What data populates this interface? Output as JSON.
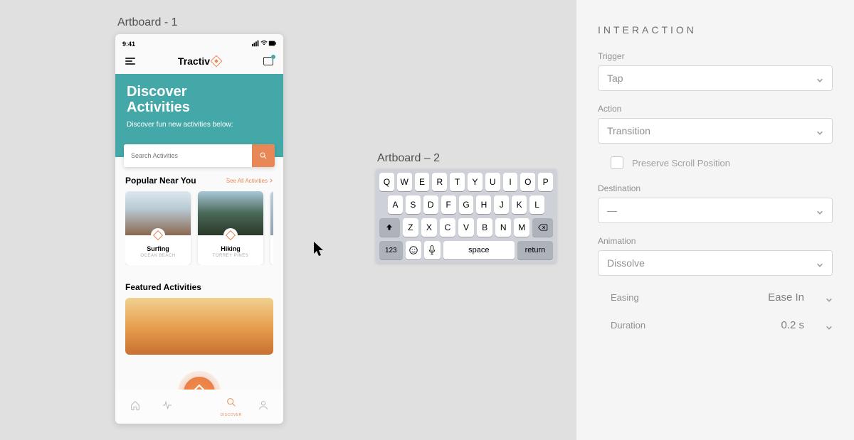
{
  "artboard1_label": "Artboard - 1",
  "artboard2_label": "Artboard – 2",
  "phone": {
    "time": "9:41",
    "brand": "Tractiv",
    "hero_title_line1": "Discover",
    "hero_title_line2": "Activities",
    "hero_sub": "Discover fun new activities below:",
    "search_placeholder": "Search Activities",
    "section_title": "Popular Near You",
    "see_all": "See All Activities",
    "cards": [
      {
        "name": "Surfing",
        "sub": "OCEAN BEACH"
      },
      {
        "name": "Hiking",
        "sub": "TORREY PINES"
      }
    ],
    "featured_title": "Featured Activities",
    "tab_discover": "DISCOVER"
  },
  "keyboard": {
    "row1": [
      "Q",
      "W",
      "E",
      "R",
      "T",
      "Y",
      "U",
      "I",
      "O",
      "P"
    ],
    "row2": [
      "A",
      "S",
      "D",
      "F",
      "G",
      "H",
      "J",
      "K",
      "L"
    ],
    "row3": [
      "Z",
      "X",
      "C",
      "V",
      "B",
      "N",
      "M"
    ],
    "num": "123",
    "space": "space",
    "return": "return"
  },
  "panel": {
    "title": "INTERACTION",
    "trigger_label": "Trigger",
    "trigger_value": "Tap",
    "action_label": "Action",
    "action_value": "Transition",
    "preserve_scroll": "Preserve Scroll Position",
    "destination_label": "Destination",
    "destination_value": "—",
    "animation_label": "Animation",
    "animation_value": "Dissolve",
    "easing_label": "Easing",
    "easing_value": "Ease In",
    "duration_label": "Duration",
    "duration_value": "0.2 s"
  }
}
